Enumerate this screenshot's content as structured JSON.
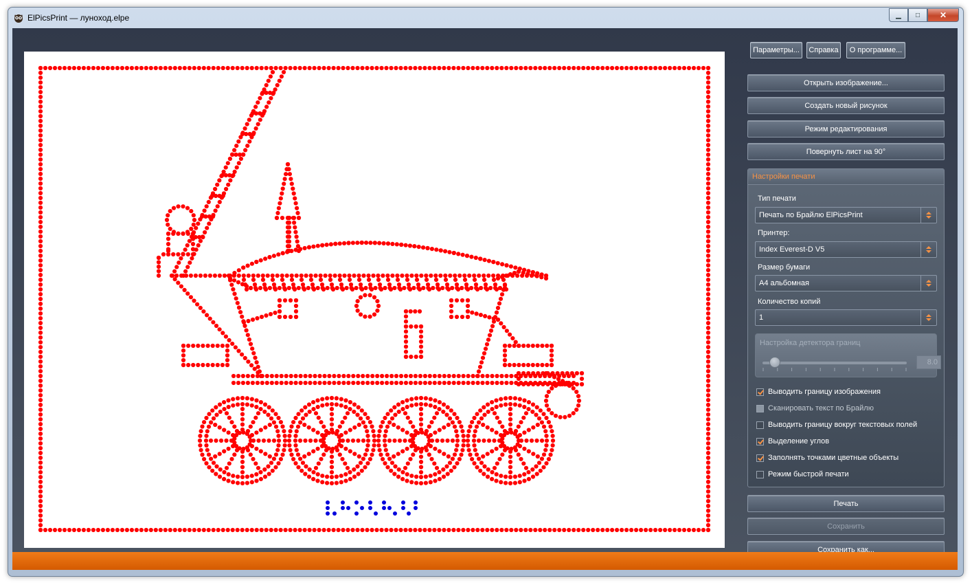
{
  "window": {
    "title": "ElPicsPrint — луноход.elpe",
    "minimize_glyph": "▁",
    "maximize_glyph": "□",
    "close_glyph": "✕"
  },
  "toolbar": {
    "params_label": "Параметры...",
    "help_label": "Справка",
    "about_label": "О программе..."
  },
  "actions": {
    "open_image": "Открыть изображение...",
    "new_drawing": "Создать новый рисунок",
    "edit_mode": "Режим редактирования",
    "rotate_sheet": "Повернуть лист на 90°"
  },
  "print_settings": {
    "title": "Настройки печати",
    "print_type_label": "Тип печати",
    "print_type_value": "Печать по Брайлю ElPicsPrint",
    "printer_label": "Принтер:",
    "printer_value": "Index Everest-D V5",
    "paper_label": "Размер бумаги",
    "paper_value": "A4 альбомная",
    "copies_label": "Количество копий",
    "copies_value": "1",
    "edge_group_title": "Настройка детектора границ",
    "edge_value": "8.0",
    "edge_level": 0.08,
    "checkboxes": [
      {
        "label": "Выводить границу изображения",
        "checked": true
      },
      {
        "label": "Сканировать текст по Брайлю",
        "checked": false,
        "disabled": true
      },
      {
        "label": "Выводить границу вокруг текстовых полей",
        "checked": false
      },
      {
        "label": "Выделение углов",
        "checked": true
      },
      {
        "label": "Заполнять точками цветные объекты",
        "checked": true
      },
      {
        "label": "Режим быстрой печати",
        "checked": false
      }
    ]
  },
  "bottom": {
    "print": "Печать",
    "save": "Сохранить",
    "save_as": "Сохранить как..."
  },
  "colors": {
    "dots": "#ff0000",
    "braille": "#0000dd",
    "accent": "#f79245",
    "status_bar": "#e86a0a"
  }
}
